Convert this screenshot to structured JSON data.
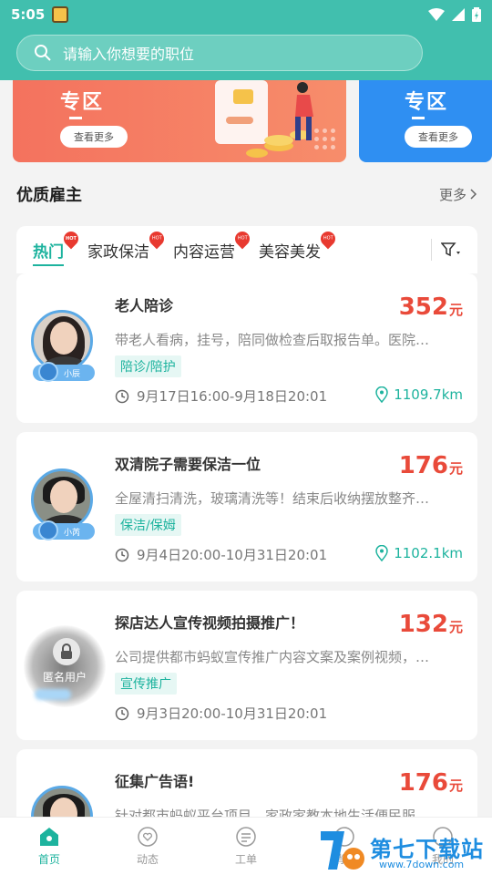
{
  "status": {
    "time": "5:05"
  },
  "search": {
    "placeholder": "请输入你想要的职位"
  },
  "banners": [
    {
      "title": "专区",
      "button": "查看更多"
    },
    {
      "title": "专区",
      "button": "查看更多"
    }
  ],
  "section": {
    "title": "优质雇主",
    "more": "更多"
  },
  "tabs": [
    {
      "label": "热门",
      "hot": true,
      "active": true
    },
    {
      "label": "家政保洁",
      "hot": true
    },
    {
      "label": "内容运营",
      "hot": true
    },
    {
      "label": "美容美发",
      "hot": true
    }
  ],
  "hot_badge": "HOT",
  "cards": [
    {
      "title": "老人陪诊",
      "price": "352",
      "unit": "元",
      "desc": "带老人看病，挂号，陪同做检查后取报告单。医院…",
      "tag": "陪诊/陪护",
      "time": "9月17日16:00-9月18日20:01",
      "distance": "1109.7km",
      "badge": "小辰"
    },
    {
      "title": "双清院子需要保洁一位",
      "price": "176",
      "unit": "元",
      "desc": "全屋清扫清洗，玻璃清洗等！结束后收纳摆放整齐…",
      "tag": "保洁/保姆",
      "time": "9月4日20:00-10月31日20:01",
      "distance": "1102.1km",
      "badge": "小芮"
    },
    {
      "title": "探店达人宣传视频拍摄推广！",
      "price": "132",
      "unit": "元",
      "desc": "公司提供都市蚂蚁宣传推广内容文案及案例视频，…",
      "tag": "宣传推广",
      "time": "9月3日20:00-10月31日20:01",
      "anon_label": "匿名用户"
    },
    {
      "title": "征集广告语!",
      "price": "176",
      "unit": "元",
      "desc": "针对都市蚂蚁平台项目，家政家教本地生活便民服"
    }
  ],
  "tabbar": [
    {
      "label": "首页",
      "icon": "home-icon",
      "active": true
    },
    {
      "label": "动态",
      "icon": "heart-chat-icon"
    },
    {
      "label": "工单",
      "icon": "list-icon"
    },
    {
      "label": "消息",
      "icon": "message-icon"
    },
    {
      "label": "我的",
      "icon": "user-icon"
    }
  ],
  "watermark": {
    "text": "第七下载站",
    "url": "www.7down.com"
  },
  "colors": {
    "primary": "#41bfae",
    "accent": "#1db39e",
    "price": "#e94a3a"
  }
}
